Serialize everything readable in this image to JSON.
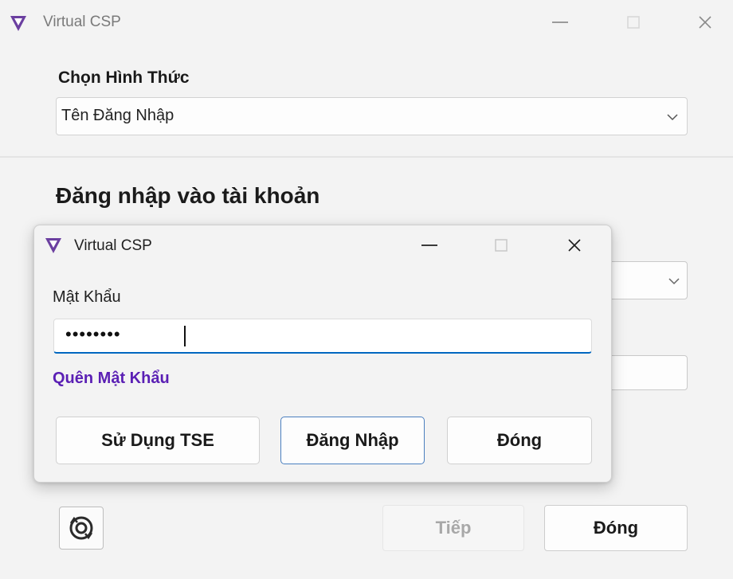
{
  "main_window": {
    "title": "Virtual CSP",
    "method_label": "Chọn Hình Thức",
    "method_select": {
      "selected": "Tên Đăng Nhập"
    },
    "heading": "Đăng nhập vào tài khoản",
    "buttons": {
      "next_label": "Tiếp",
      "close_label": "Đóng"
    }
  },
  "dialog": {
    "title": "Virtual CSP",
    "password_label": "Mật Khẩu",
    "password_value": "••••••••",
    "forgot_link": "Quên Mật Khẩu",
    "buttons": {
      "use_tse_label": "Sử Dụng TSE",
      "login_label": "Đăng Nhập",
      "close_label": "Đóng"
    }
  },
  "colors": {
    "logo": "#6b3fa0",
    "link": "#5a1fb4",
    "focus_underline": "#0067c0",
    "login_border": "#4a7fbf"
  },
  "icons": [
    "app-logo-icon",
    "minimize-icon",
    "maximize-icon",
    "close-icon",
    "chevron-down-icon",
    "refresh-settings-icon"
  ]
}
